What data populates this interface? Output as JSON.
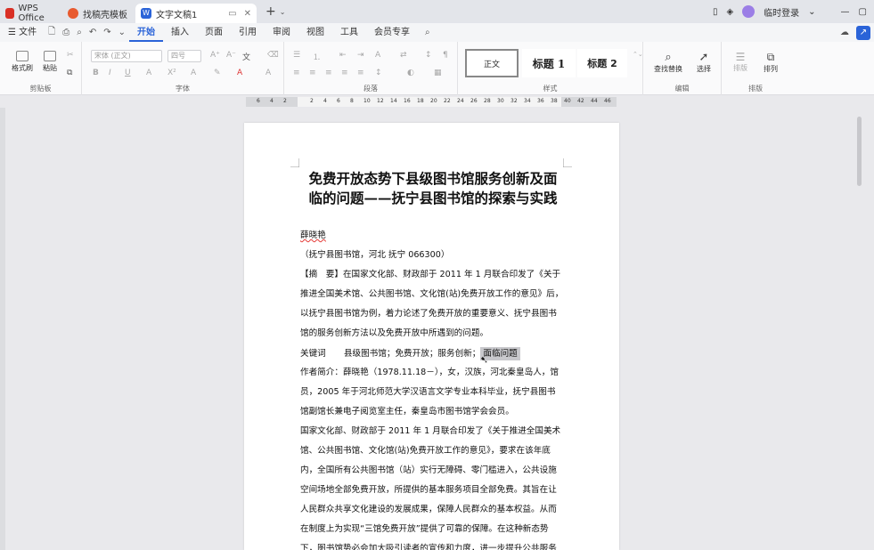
{
  "tabs": [
    {
      "label": "WPS Office",
      "color": "#d93025"
    },
    {
      "label": "找稿壳模板",
      "color": "#e85a2f"
    },
    {
      "label": "文字文稿1",
      "color": "#2a63d8"
    }
  ],
  "titlebar": {
    "login": "临时登录"
  },
  "menu": {
    "file": "文件",
    "items": [
      "开始",
      "插入",
      "页面",
      "引用",
      "审阅",
      "视图",
      "工具",
      "会员专享"
    ],
    "active": "开始"
  },
  "ribbon": {
    "clipboard": {
      "format_painter": "格式刷",
      "paste": "粘贴",
      "label": "剪贴板"
    },
    "font": {
      "font_name": "宋体 (正文)",
      "font_size": "四号",
      "label": "字体"
    },
    "paragraph": {
      "label": "段落"
    },
    "styles": {
      "normal": "正文",
      "h1": "标题 1",
      "h2": "标题 2",
      "label": "样式"
    },
    "edit": {
      "find_replace": "查找替换",
      "select": "选择",
      "label": "编辑"
    },
    "layout": {
      "typeset": "排版",
      "arrange": "排列",
      "label": "排版"
    }
  },
  "ruler_ticks": [
    "6",
    "4",
    "2",
    "",
    "2",
    "4",
    "6",
    "8",
    "10",
    "12",
    "14",
    "16",
    "18",
    "20",
    "22",
    "24",
    "26",
    "28",
    "30",
    "32",
    "34",
    "36",
    "38",
    "40",
    "42",
    "44",
    "46"
  ],
  "document": {
    "title_line1": "免费开放态势下县级图书馆服务创新及面",
    "title_line2": "临的问题——抚宁县图书馆的探索与实践",
    "author": "薛晓艳",
    "affiliation": "（抚宁县图书馆，河北 抚宁 066300）",
    "abstract": [
      "【摘　要】在国家文化部、财政部于 2011 年 1 月联合印发了《关于",
      "推进全国美术馆、公共图书馆、文化馆(站)免费开放工作的意见》后，",
      "以抚宁县图书馆为例，着力论述了免费开放的重要意义、抚宁县图书",
      "馆的服务创新方法以及免费开放中所遇到的问题。"
    ],
    "keywords_label": "关键词",
    "keywords": "县级图书馆；免费开放；服务创新；",
    "keywords_selected": "面临问题",
    "bio": [
      "作者简介：薛晓艳（1978.11.18－），女，汉族，河北秦皇岛人，馆",
      "员，2005 年于河北师范大学汉语言文学专业本科毕业，抚宁县图书",
      "馆副馆长兼电子阅览室主任，秦皇岛市图书馆学会会员。"
    ],
    "body": [
      "国家文化部、财政部于 2011 年 1 月联合印发了《关于推进全国美术",
      "馆、公共图书馆、文化馆(站)免费开放工作的意见》，要求在该年底",
      "内，全国所有公共图书馆（站）实行无障碍、零门槛进入，公共设施",
      "空间场地全部免费开放，所提供的基本服务项目全部免费。其旨在让",
      "人民群众共享文化建设的发展成果，保障人民群众的基本权益。从而",
      "在制度上为实现“三馆免费开放”提供了可靠的保障。在这种新态势",
      "下，图书馆势必会加大吸引读者的宣传和力度，进一步提升公共服务"
    ]
  }
}
